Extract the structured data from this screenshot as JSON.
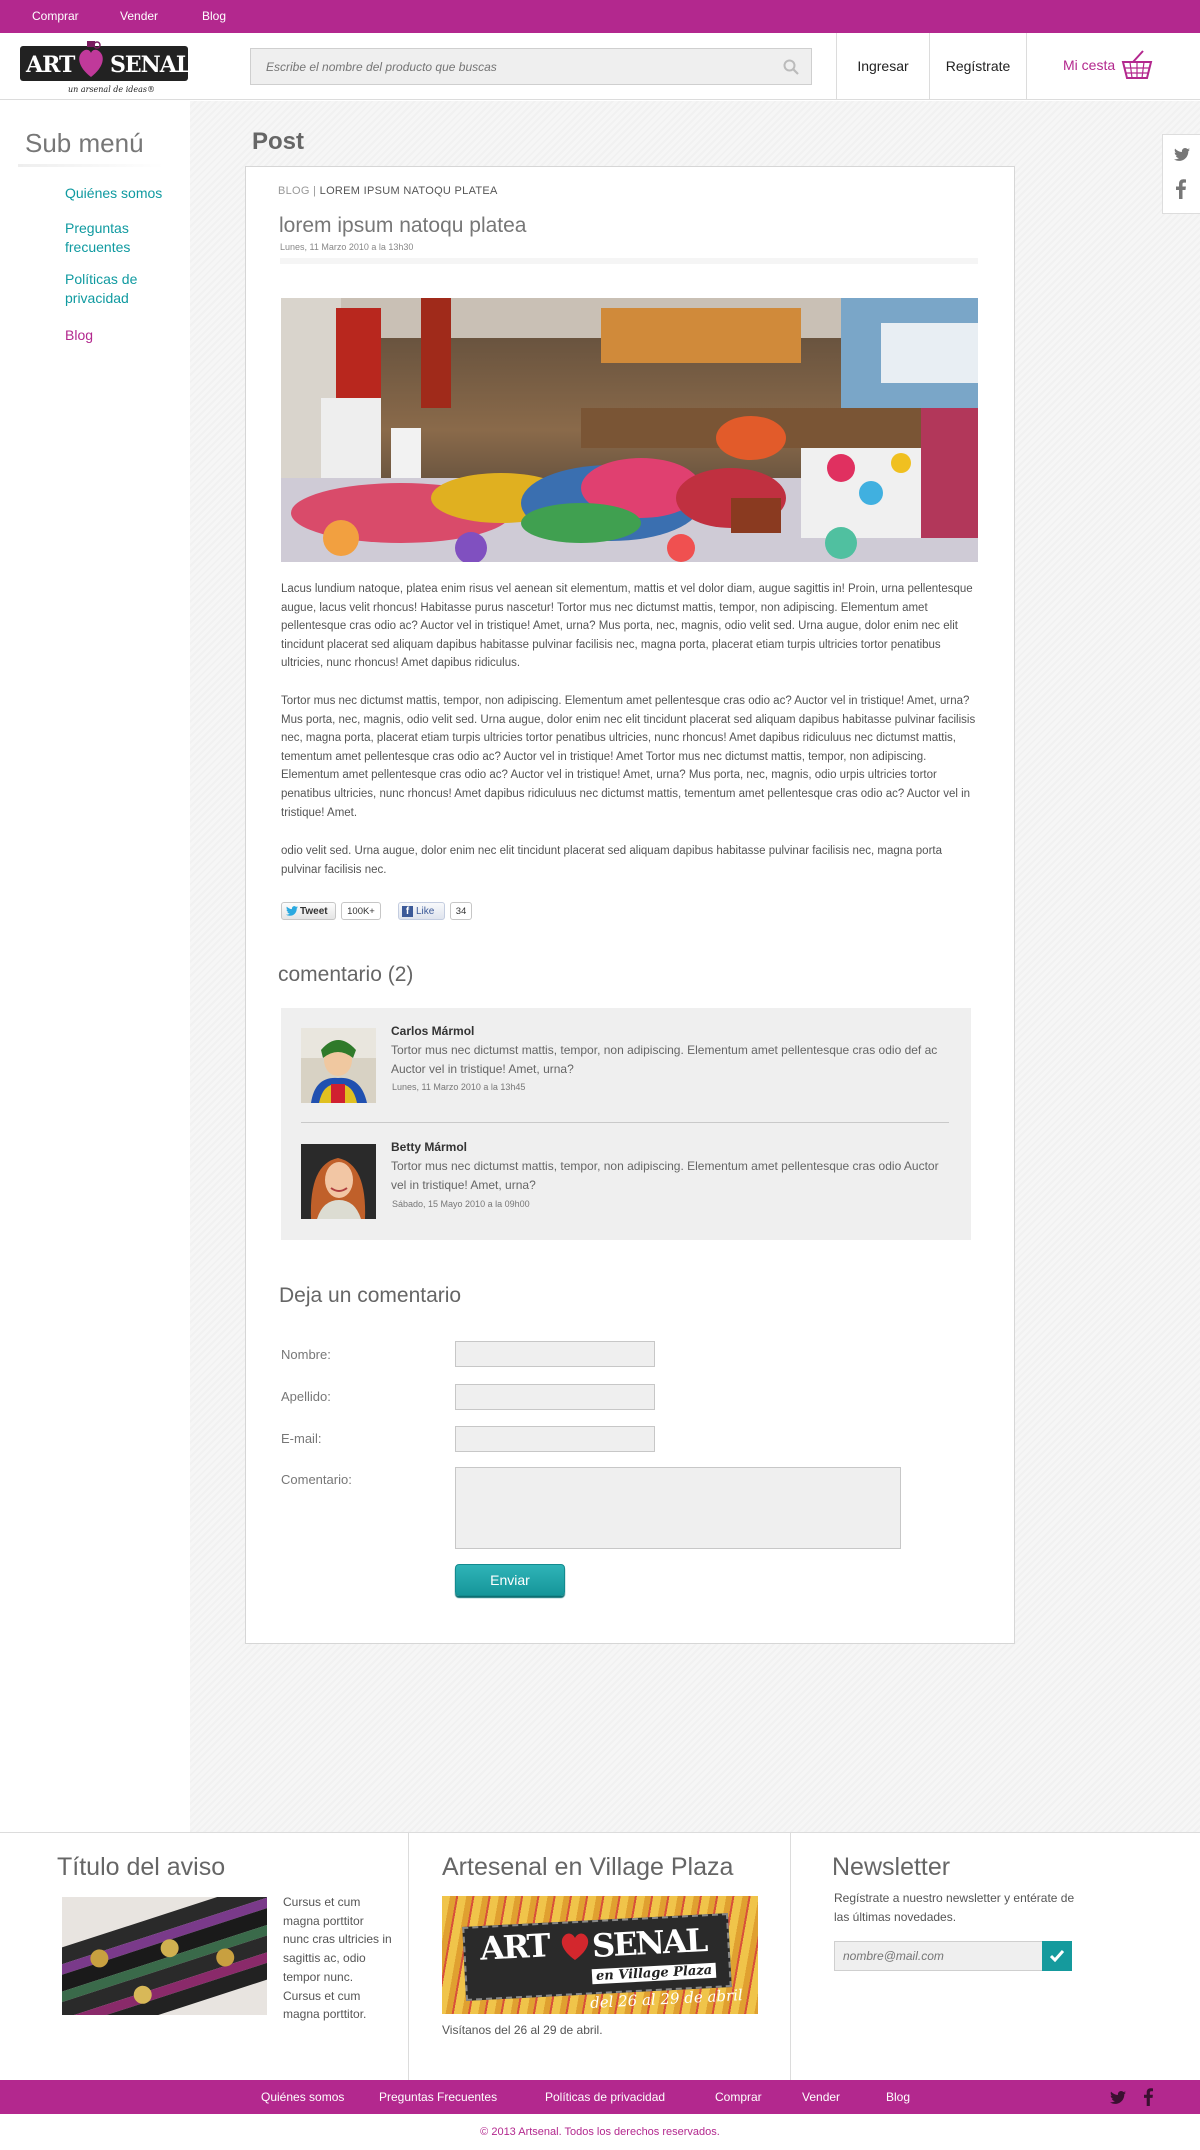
{
  "topnav": {
    "items": [
      "Comprar",
      "Vender",
      "Blog"
    ]
  },
  "header": {
    "logo_text_left": "ART",
    "logo_text_right": "SENAL",
    "logo_tagline": "un arsenal de ideas®",
    "search_placeholder": "Escribe el nombre del producto que buscas",
    "login_label": "Ingresar",
    "register_label": "Regístrate",
    "cart_label": "Mi cesta"
  },
  "sidebar": {
    "title": "Sub menú",
    "items": [
      {
        "label": "Quiénes somos"
      },
      {
        "label": "Preguntas frecuentes"
      },
      {
        "label": "Políticas de privacidad"
      },
      {
        "label": "Blog"
      }
    ]
  },
  "page": {
    "heading": "Post"
  },
  "post": {
    "breadcrumb_root": "BLOG",
    "breadcrumb_current": "LOREM IPSUM NATOQU PLATEA",
    "title": "lorem ipsum natoqu platea",
    "date": "Lunes, 11 Marzo 2010 a la 13h30",
    "paragraphs": [
      "Lacus lundium natoque, platea enim risus vel aenean sit elementum, mattis et vel dolor diam, augue sagittis in! Proin, urna pellentesque augue, lacus velit rhoncus! Habitasse purus nascetur! Tortor mus nec dictumst mattis, tempor, non adipiscing. Elementum amet pellentesque cras odio ac? Auctor vel in tristique! Amet, urna? Mus porta, nec, magnis, odio velit sed. Urna augue, dolor enim nec elit tincidunt placerat sed aliquam dapibus habitasse pulvinar facilisis nec, magna porta, placerat etiam turpis ultricies tortor penatibus ultricies, nunc rhoncus! Amet dapibus ridiculus.",
      "Tortor mus nec dictumst mattis, tempor, non adipiscing. Elementum amet pellentesque cras odio ac? Auctor vel in tristique! Amet, urna? Mus porta, nec, magnis, odio velit sed. Urna augue, dolor enim nec elit tincidunt placerat sed aliquam dapibus habitasse pulvinar facilisis nec, magna porta, placerat etiam turpis ultricies tortor penatibus ultricies, nunc rhoncus! Amet dapibus ridiculuus nec dictumst mattis, tementum amet pellentesque cras odio ac? Auctor vel in tristique! Amet Tortor mus nec dictumst mattis, tempor, non adipiscing. Elementum amet pellentesque cras odio ac? Auctor vel in tristique! Amet, urna? Mus porta, nec, magnis, odio urpis ultricies tortor penatibus ultricies, nunc rhoncus! Amet dapibus ridiculuus nec dictumst mattis, tementum amet pellentesque cras odio ac? Auctor vel in tristique! Amet.",
      "odio velit sed. Urna augue, dolor enim nec elit tincidunt placerat sed aliquam dapibus habitasse pulvinar facilisis nec, magna porta pulvinar facilisis nec."
    ],
    "tweet_label": "Tweet",
    "tweet_count": "100K+",
    "like_label": "Like",
    "like_count": "34"
  },
  "comments": {
    "title": "comentario (2)",
    "items": [
      {
        "name": "Carlos Mármol",
        "text": "Tortor mus nec dictumst mattis, tempor, non adipiscing. Elementum amet pellentesque cras odio def ac Auctor vel in tristique! Amet, urna?",
        "date": "Lunes, 11 Marzo 2010 a la 13h45"
      },
      {
        "name": "Betty Mármol",
        "text": "Tortor mus nec dictumst mattis, tempor, non adipiscing. Elementum amet pellentesque cras odio  Auctor vel in tristique! Amet, urna?",
        "date": "Sábado, 15 Mayo 2010 a la 09h00"
      }
    ]
  },
  "form": {
    "title": "Deja un comentario",
    "name_label": "Nombre:",
    "surname_label": "Apellido:",
    "email_label": "E-mail:",
    "comment_label": "Comentario:",
    "submit_label": "Enviar"
  },
  "footer": {
    "ad_title": "Título del aviso",
    "ad_text": "Cursus et cum magna porttitor nunc cras ultricies in sagittis ac, odio tempor nunc. Cursus et cum magna porttitor.",
    "event_title": "Artesenal en Village Plaza",
    "event_banner_line1": "ART",
    "event_banner_line2": "SENAL",
    "event_banner_sub": "en Village Plaza",
    "event_banner_dates": "del 26 al 29 de abril",
    "event_text": "Visítanos del 26 al 29 de abril.",
    "newsletter_title": "Newsletter",
    "newsletter_text": "Regístrate a nuestro newsletter y entérate de las últimas novedades.",
    "newsletter_placeholder": "nombre@mail.com",
    "links": [
      "Quiénes somos",
      "Preguntas Frecuentes",
      "Políticas de privacidad",
      "Comprar",
      "Vender",
      "Blog"
    ],
    "copyright": "© 2013 Artsenal. Todos los derechos reservados."
  },
  "colors": {
    "brand": "#b3288e",
    "accent": "#0f9aa0"
  }
}
